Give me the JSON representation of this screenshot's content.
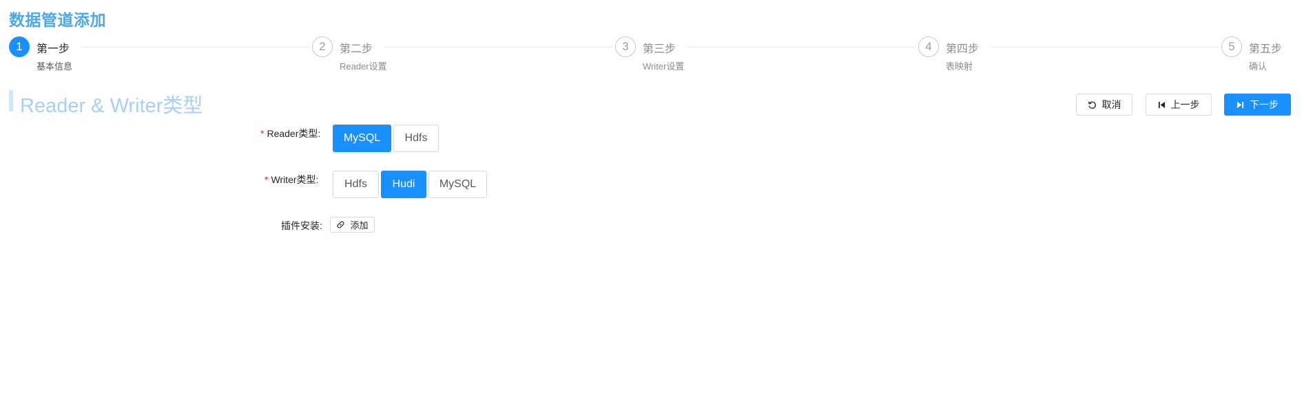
{
  "page": {
    "title": "数据管道添加"
  },
  "steps": [
    {
      "number": "1",
      "title": "第一步",
      "desc": "基本信息",
      "state": "active"
    },
    {
      "number": "2",
      "title": "第二步",
      "desc": "Reader设置",
      "state": "wait"
    },
    {
      "number": "3",
      "title": "第三步",
      "desc": "Writer设置",
      "state": "wait"
    },
    {
      "number": "4",
      "title": "第四步",
      "desc": "表映射",
      "state": "wait"
    },
    {
      "number": "5",
      "title": "第五步",
      "desc": "确认",
      "state": "wait"
    }
  ],
  "section": {
    "title": "Reader & Writer类型"
  },
  "actions": {
    "cancel": {
      "label": "取消",
      "icon": "undo-icon"
    },
    "prev": {
      "label": "上一步",
      "icon": "step-backward-icon"
    },
    "next": {
      "label": "下一步",
      "icon": "step-forward-icon"
    }
  },
  "form": {
    "reader": {
      "label": "Reader类型",
      "required": "*",
      "colon": ":",
      "options": [
        "MySQL",
        "Hdfs"
      ],
      "selected": "MySQL"
    },
    "writer": {
      "label": "Writer类型",
      "required": "*",
      "colon": ":",
      "options": [
        "Hdfs",
        "Hudi",
        "MySQL"
      ],
      "selected": "Hudi"
    },
    "plugin": {
      "label": "插件安装",
      "colon": ":",
      "button": "添加",
      "icon": "link-icon"
    }
  },
  "colors": {
    "primary": "#1890ff",
    "title": "#4aa8f0",
    "section_title": "#a8cff5",
    "required": "#f5222d"
  }
}
